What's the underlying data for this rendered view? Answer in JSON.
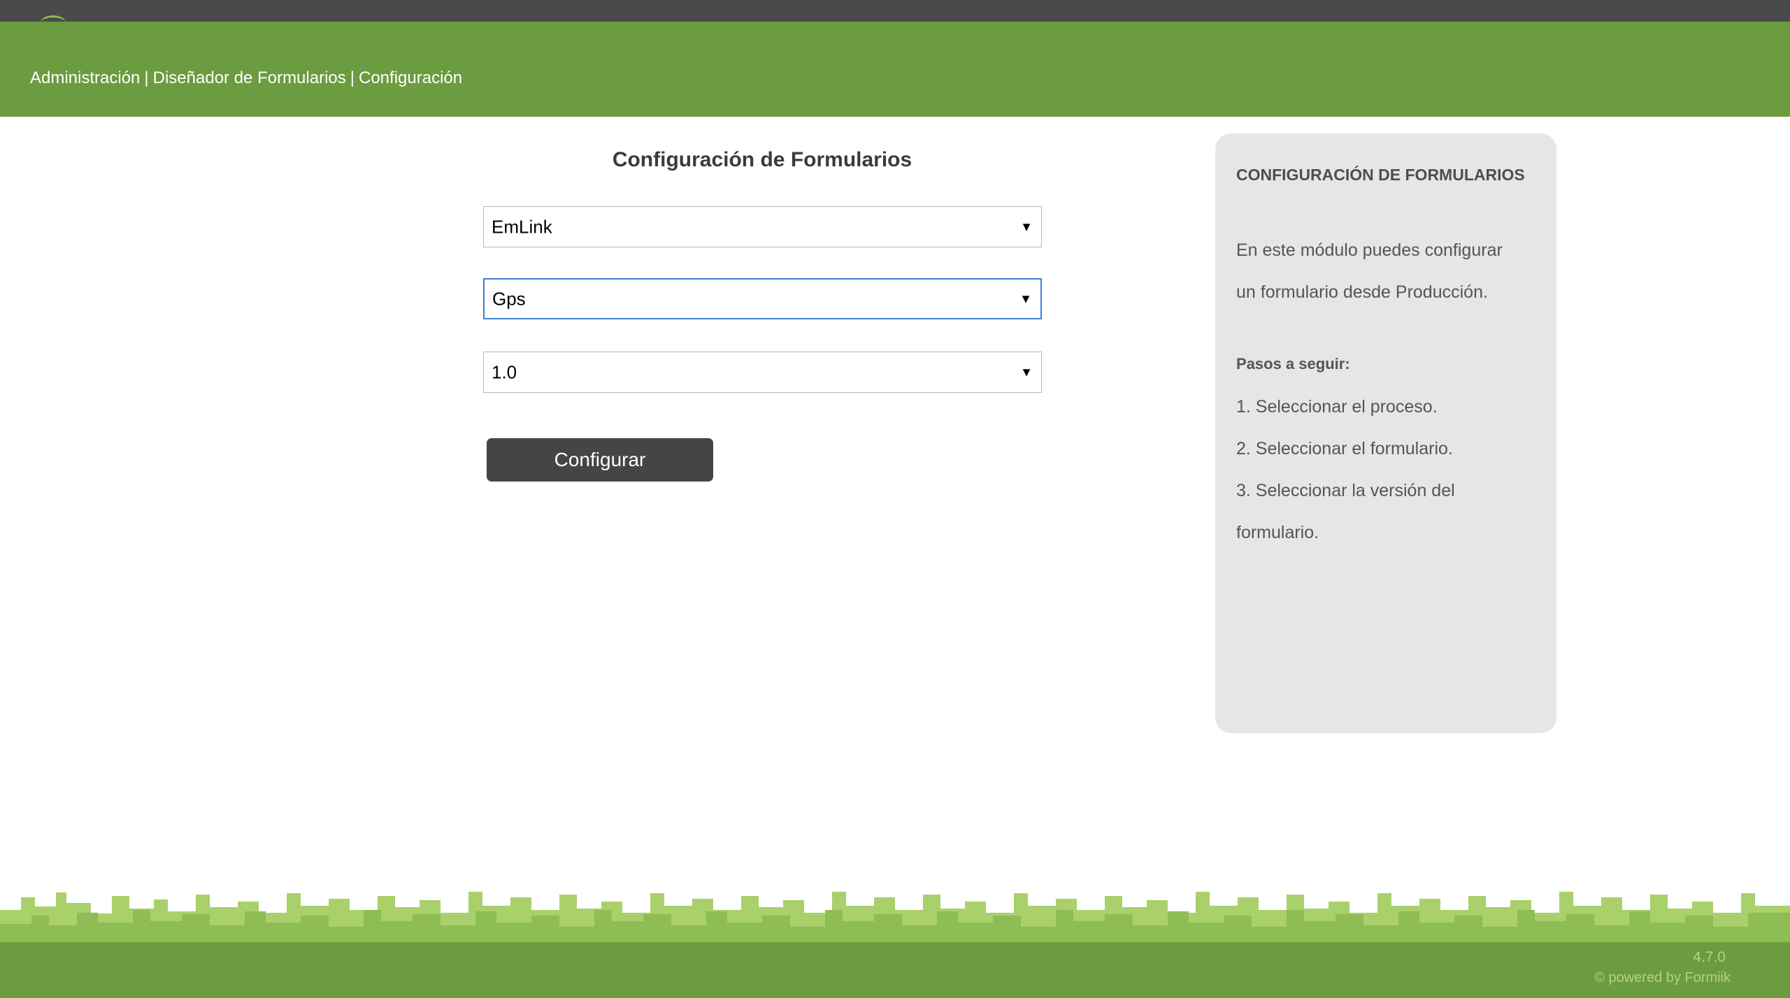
{
  "breadcrumb": {
    "items": [
      "Administración",
      "Diseñador de Formularios",
      "Configuración"
    ],
    "separator": "|"
  },
  "form": {
    "title": "Configuración de Formularios",
    "process_select": "EmLink",
    "form_select": "Gps",
    "version_select": "1.0",
    "submit_label": "Configurar"
  },
  "help": {
    "title": "CONFIGURACIÓN DE FORMULARIOS",
    "intro_line1": "En este módulo puedes configurar",
    "intro_line2": "un formulario desde Producción.",
    "steps_title": "Pasos a seguir:",
    "step1": "1. Seleccionar el proceso.",
    "step2": "2. Seleccionar el formulario.",
    "step3_line1": "3. Seleccionar la versión del",
    "step3_line2": "formulario."
  },
  "footer": {
    "version": "4.7.0",
    "powered_by": "© powered by Formiik"
  },
  "icons": {
    "select_caret": "caret-down-icon",
    "logo": "logo-icon"
  },
  "colors": {
    "header_green": "#6b9c3f",
    "topbar": "#4a4a4a",
    "button": "#454545",
    "focus_border": "#3d7fd6",
    "panel_bg": "#e5e6e7"
  }
}
